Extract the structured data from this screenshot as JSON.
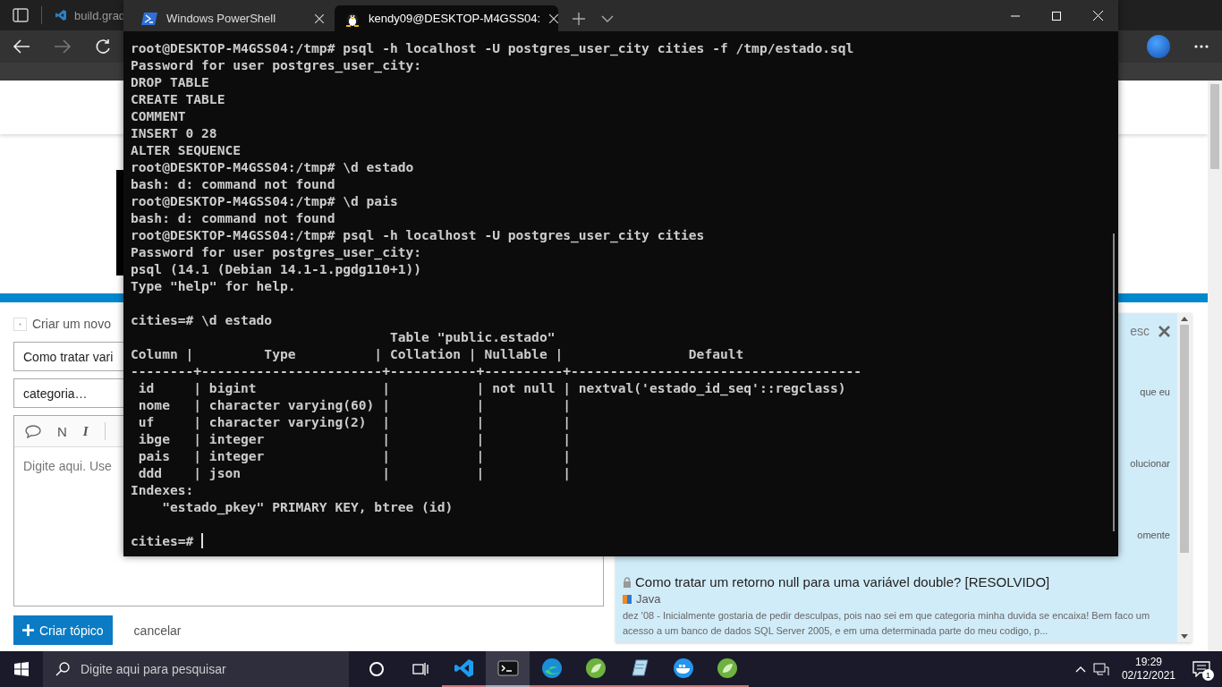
{
  "browser": {
    "tabs": [
      {
        "title": "build.grad"
      }
    ],
    "page": {
      "composer": {
        "heading": "Criar um novo",
        "title_value": "Como tratar vari",
        "category_value": "categoria…",
        "toolbar": [
          "N",
          "I"
        ],
        "body_placeholder": "Digite aqui. Use",
        "submit": "Criar tópico",
        "cancel": "cancelar"
      },
      "search_panel": {
        "close_hint": "esc",
        "fragments": [
          "que eu",
          "olucionar",
          "omente"
        ],
        "result": {
          "title": "Como tratar um retorno null para uma variável double? [RESOLVIDO]",
          "category": "Java",
          "excerpt": "dez '08 - Inicialmente gostaria de pedir desculpas, pois nao sei em que categoria minha duvida se encaixa! Bem faco um acesso a um banco de dados SQL Server 2005, e em uma determinada parte do meu codigo, p..."
        }
      }
    }
  },
  "terminal": {
    "tabs": [
      {
        "title": "Windows PowerShell",
        "selected": false
      },
      {
        "title": "kendy09@DESKTOP-M4GSS04:",
        "selected": true
      }
    ],
    "blocks": [
      [
        "root@DESKTOP-M4GSS04:/tmp# psql -h localhost -U postgres_user_city cities -f /tmp/estado.sql",
        "Password for user postgres_user_city:",
        "DROP TABLE",
        "CREATE TABLE",
        "COMMENT",
        "INSERT 0 28",
        "ALTER SEQUENCE",
        "root@DESKTOP-M4GSS04:/tmp# \\d estado",
        "bash: d: command not found",
        "root@DESKTOP-M4GSS04:/tmp# \\d pais",
        "bash: d: command not found",
        "root@DESKTOP-M4GSS04:/tmp# psql -h localhost -U postgres_user_city cities",
        "Password for user postgres_user_city:",
        "psql (14.1 (Debian 14.1-1.pgdg110+1))",
        "Type \"help\" for help."
      ],
      [
        "cities=# \\d estado",
        "                                 Table \"public.estado\"",
        "Column |         Type          | Collation | Nullable |                Default",
        "--------+-----------------------+-----------+----------+-------------------------------------",
        " id     | bigint                |           | not null | nextval('estado_id_seq'::regclass)",
        " nome   | character varying(60) |           |          |",
        " uf     | character varying(2)  |           |          |",
        " ibge   | integer               |           |          |",
        " pais   | integer               |           |          |",
        " ddd    | json                  |           |          |",
        "Indexes:",
        "    \"estado_pkey\" PRIMARY KEY, btree (id)"
      ],
      [
        "cities=# "
      ]
    ],
    "cursor": true
  },
  "taskbar": {
    "search_placeholder": "Digite aqui para pesquisar",
    "apps": [
      {
        "kind": "vscode",
        "active": false
      },
      {
        "kind": "terminal",
        "active": true
      },
      {
        "kind": "edge",
        "active": false
      },
      {
        "kind": "spring",
        "active": false
      },
      {
        "kind": "notepad",
        "active": false
      },
      {
        "kind": "docker",
        "active": false
      },
      {
        "kind": "spring",
        "active": false
      }
    ],
    "time": "19:29",
    "date": "02/12/2021",
    "notifications": "1"
  }
}
